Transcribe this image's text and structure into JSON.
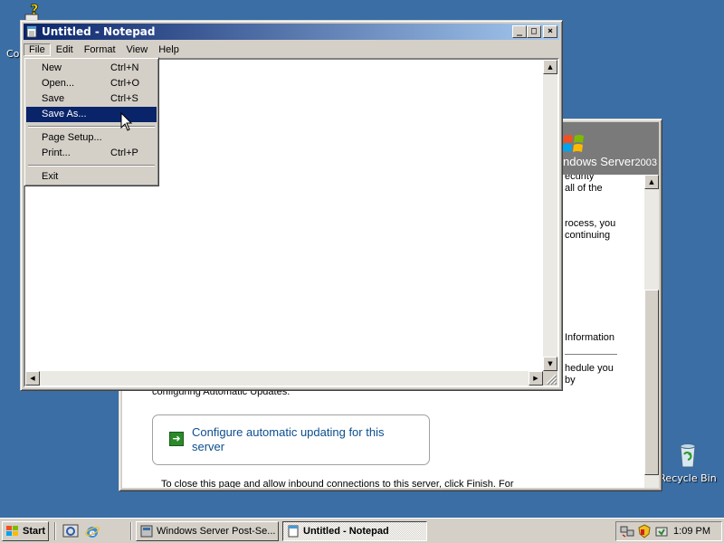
{
  "desktop": {
    "top_icon_label_fragment": "Co",
    "recycle_bin_label": "Recycle Bin"
  },
  "post_setup": {
    "logo_text": "ndows Server",
    "logo_year": "2003",
    "fragments": {
      "l1": "ecurity",
      "l2": "all of the",
      "l3": "rocess, you",
      "l4": "continuing",
      "l5": "Information",
      "l6": "hedule you",
      "l7": "by",
      "l8": "configuring Automatic Updates."
    },
    "config_link": "Configure automatic updating for this server",
    "footer_text": "To close this page and allow inbound connections to this server, click Finish. For"
  },
  "notepad": {
    "title": "Untitled - Notepad",
    "menu": [
      "File",
      "Edit",
      "Format",
      "View",
      "Help"
    ],
    "file_menu": {
      "new": {
        "label": "New",
        "shortcut": "Ctrl+N"
      },
      "open": {
        "label": "Open...",
        "shortcut": "Ctrl+O"
      },
      "save": {
        "label": "Save",
        "shortcut": "Ctrl+S"
      },
      "save_as": {
        "label": "Save As...",
        "shortcut": ""
      },
      "page_setup": {
        "label": "Page Setup...",
        "shortcut": ""
      },
      "print": {
        "label": "Print...",
        "shortcut": "Ctrl+P"
      },
      "exit": {
        "label": "Exit",
        "shortcut": ""
      }
    }
  },
  "taskbar": {
    "start_label": "Start",
    "tasks": [
      {
        "label": "Windows Server Post-Se...",
        "active": false
      },
      {
        "label": "Untitled - Notepad",
        "active": true
      }
    ],
    "clock": "1:09 PM"
  },
  "colors": {
    "desktop": "#3a6ea5",
    "title_active": "#0a246a",
    "menu_highlight": "#0a246a",
    "link": "#0b4e8e"
  }
}
